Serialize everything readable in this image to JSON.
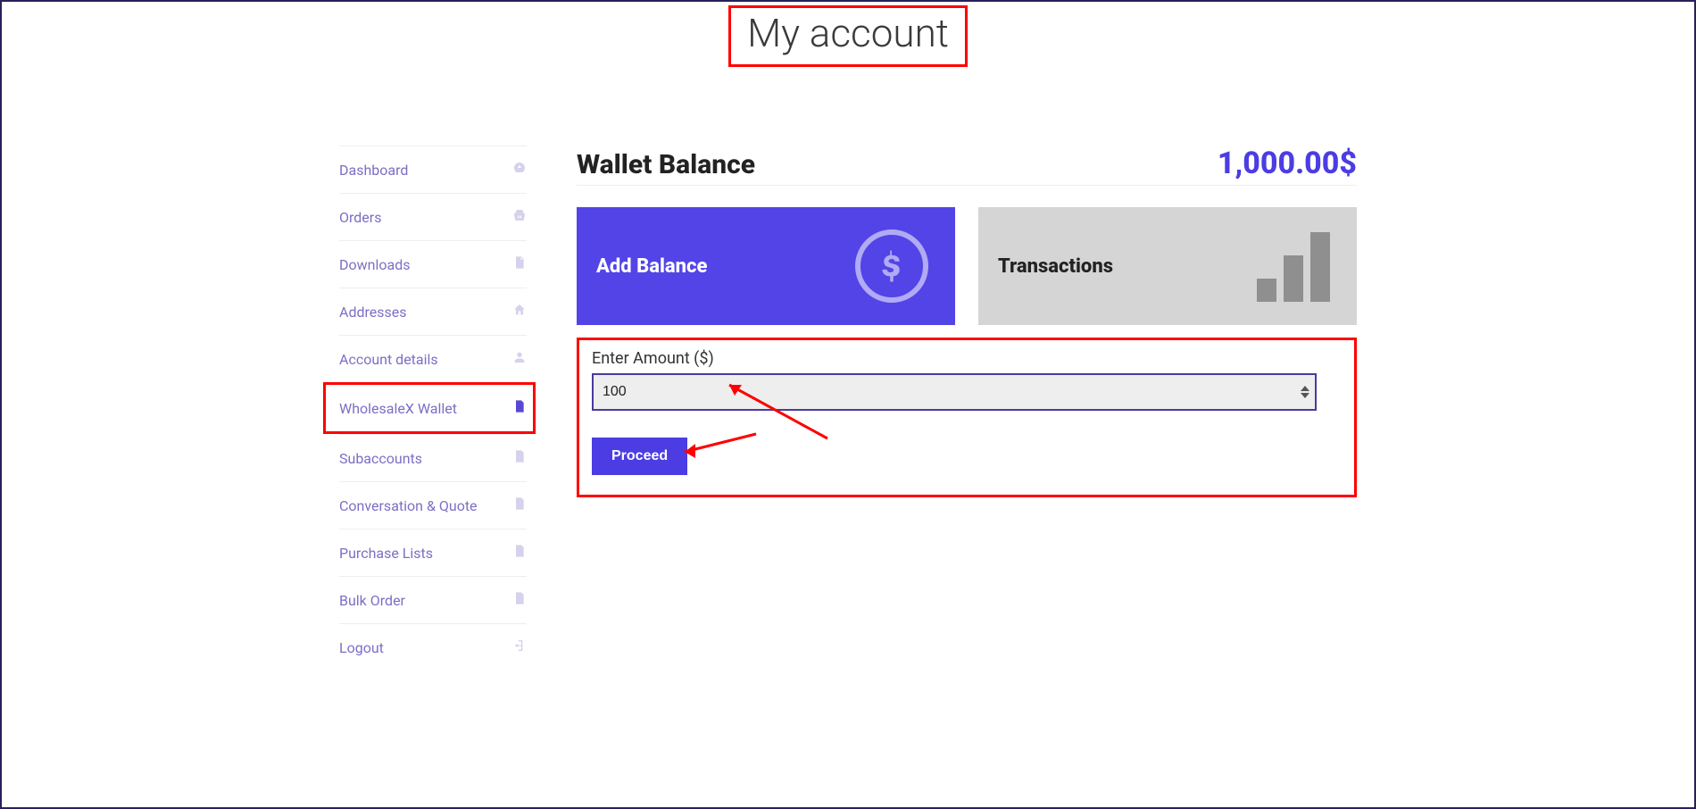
{
  "page": {
    "title": "My account"
  },
  "sidebar": {
    "items": [
      {
        "label": "Dashboard",
        "icon": "gauge-icon"
      },
      {
        "label": "Orders",
        "icon": "basket-icon"
      },
      {
        "label": "Downloads",
        "icon": "file-icon"
      },
      {
        "label": "Addresses",
        "icon": "home-icon"
      },
      {
        "label": "Account details",
        "icon": "user-icon"
      },
      {
        "label": "WholesaleX Wallet",
        "icon": "document-icon"
      },
      {
        "label": "Subaccounts",
        "icon": "document-icon"
      },
      {
        "label": "Conversation & Quote",
        "icon": "document-icon"
      },
      {
        "label": "Purchase Lists",
        "icon": "document-icon"
      },
      {
        "label": "Bulk Order",
        "icon": "document-icon"
      },
      {
        "label": "Logout",
        "icon": "logout-icon"
      }
    ]
  },
  "wallet": {
    "balance_title": "Wallet Balance",
    "balance_amount": "1,000.00$",
    "tabs": {
      "add_balance": "Add Balance",
      "transactions": "Transactions"
    },
    "form": {
      "label": "Enter Amount ($)",
      "value": "100",
      "proceed": "Proceed"
    }
  }
}
